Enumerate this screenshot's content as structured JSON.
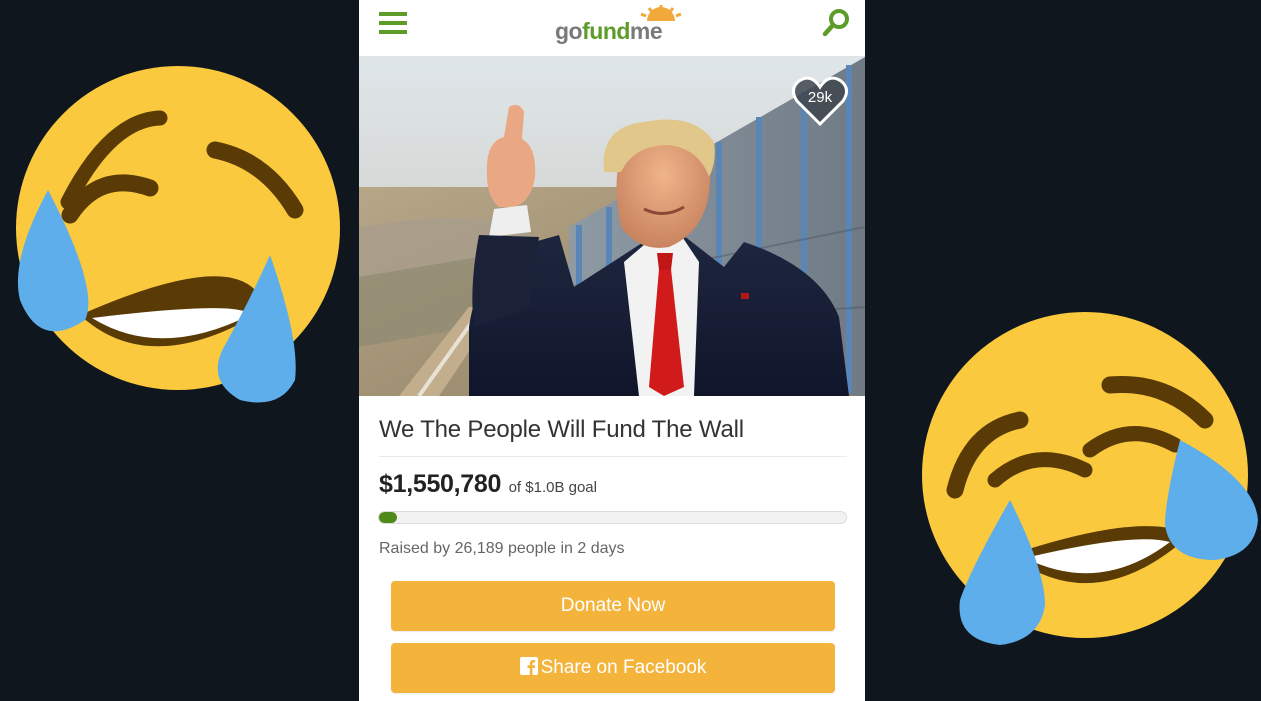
{
  "header": {
    "logo_prefix": "go",
    "logo_mid": "fund",
    "logo_suffix": "me"
  },
  "hero": {
    "likes_count": "29k"
  },
  "campaign": {
    "title": "We The People Will Fund The Wall",
    "raised_amount": "$1,550,780",
    "goal_text": "of $1.0B goal",
    "progress_fraction": 0.0016,
    "raised_by_text": "Raised by 26,189 people in 2 days"
  },
  "actions": {
    "donate_label": "Donate Now",
    "share_label": "Share on Facebook"
  },
  "colors": {
    "background": "#10161d",
    "brand_green": "#5d9c28",
    "button_orange": "#f4b43c",
    "progress_green": "#4f8a1b",
    "emoji_yellow": "#fbc93e",
    "tear_blue": "#5daeea"
  },
  "icons": {
    "menu": "hamburger-icon",
    "search": "search-icon",
    "like": "heart-icon",
    "facebook": "facebook-icon",
    "emoji": "face-with-tears-of-joy"
  }
}
